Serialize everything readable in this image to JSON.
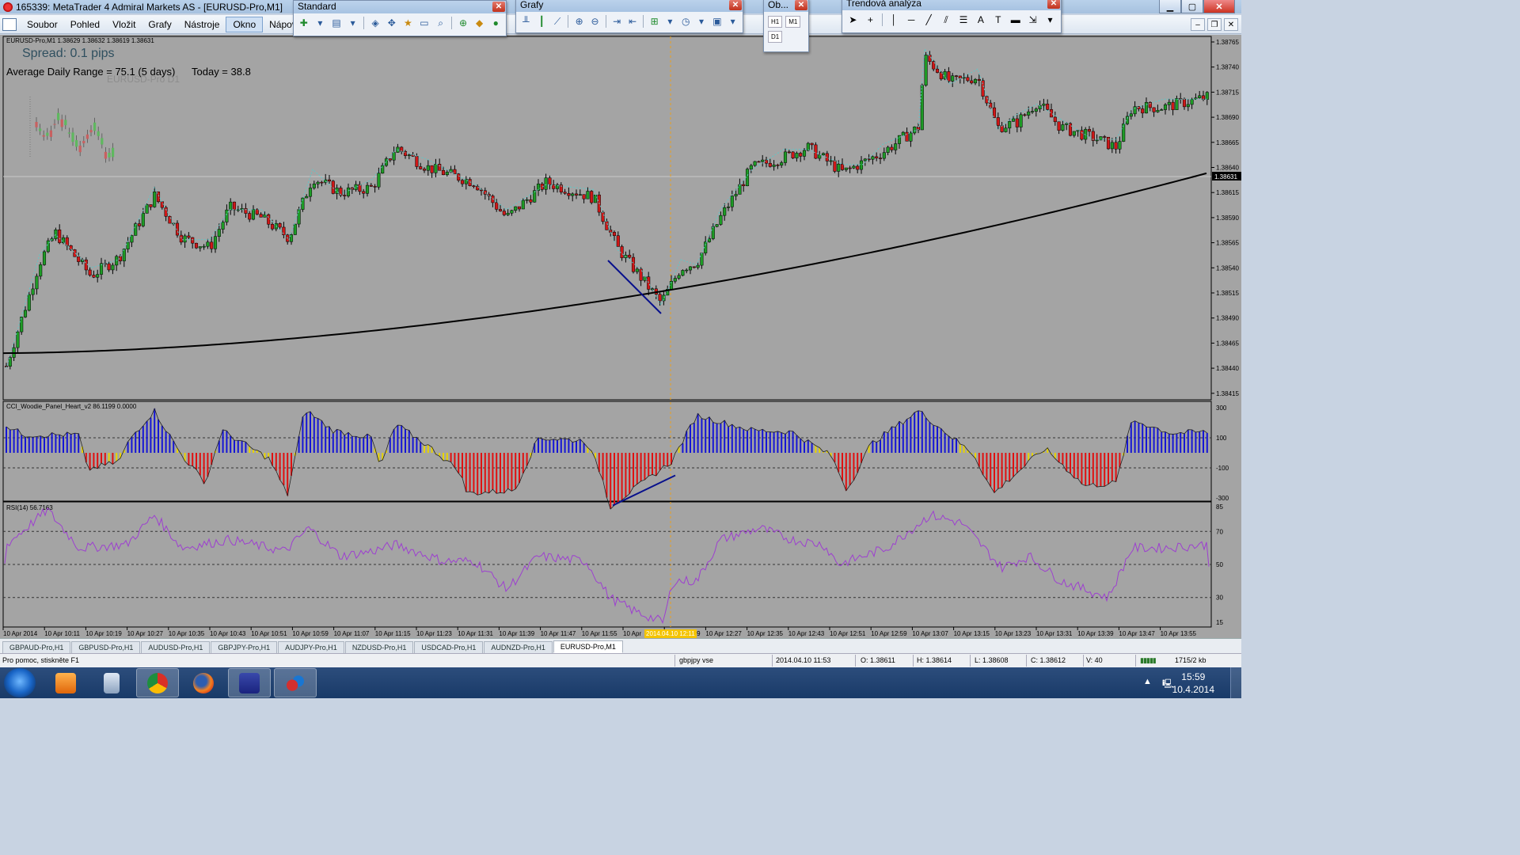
{
  "window": {
    "title": "165339: MetaTrader 4 Admiral Markets AS - [EURUSD-Pro,M1]"
  },
  "menu": [
    "Soubor",
    "Pohled",
    "Vložit",
    "Grafy",
    "Nástroje",
    "Okno",
    "Nápověda"
  ],
  "menu_active": "Okno",
  "toolbars": {
    "standard": {
      "title": "Standard"
    },
    "grafy": {
      "title": "Grafy"
    },
    "ob": {
      "title": "Ob...",
      "buttons": [
        "H1",
        "M1",
        "D1"
      ]
    },
    "trend": {
      "title": "Trendová analýza"
    }
  },
  "chart": {
    "header": "EURUSD-Pro,M1  1.38629 1.38632 1.38619 1.38631",
    "spread": "Spread: 0.1 pips",
    "adr": "Average Daily Range = 75.1 (5 days)",
    "today": "Today = 38.8",
    "mini_label": "EURUSD-Pro D1",
    "current_price": "1.38631",
    "price_axis": [
      "1.38765",
      "1.38740",
      "1.38715",
      "1.38690",
      "1.38665",
      "1.38640",
      "1.38615",
      "1.38590",
      "1.38565",
      "1.38540",
      "1.38515",
      "1.38490",
      "1.38465",
      "1.38440",
      "1.38415"
    ],
    "cci_label": "CCI_Woodie_Panel_Heart_v2 86.1199 0.0000",
    "cci_axis": [
      "300",
      "100",
      "-100",
      "-300"
    ],
    "rsi_label": "RSI(14) 56.7163",
    "rsi_axis": [
      "85",
      "70",
      "50",
      "30",
      "15"
    ],
    "time_axis": [
      "10 Apr 2014",
      "10 Apr 10:11",
      "10 Apr 10:19",
      "10 Apr 10:27",
      "10 Apr 10:35",
      "10 Apr 10:43",
      "10 Apr 10:51",
      "10 Apr 10:59",
      "10 Apr 11:07",
      "10 Apr 11:15",
      "10 Apr 11:23",
      "10 Apr 11:31",
      "10 Apr 11:39",
      "10 Apr 11:47",
      "10 Apr 11:55",
      "10 Apr",
      "10 Apr 12:19",
      "10 Apr 12:27",
      "10 Apr 12:35",
      "10 Apr 12:43",
      "10 Apr 12:51",
      "10 Apr 12:59",
      "10 Apr 13:07",
      "10 Apr 13:15",
      "10 Apr 13:23",
      "10 Apr 13:31",
      "10 Apr 13:39",
      "10 Apr 13:47",
      "10 Apr 13:55"
    ],
    "cursor_time": "2014.04.10 12:11",
    "colors": {
      "bull": "#1e9b26",
      "bear": "#d01818",
      "cci_pos": "#1515d6",
      "cci_neg": "#e01010",
      "cci_neutral": "#e8d400",
      "rsi": "#9d3fd0",
      "zigzag": "#5fc7c7",
      "ma": "#000000",
      "trendline": "#08108c",
      "background": "#a4a4a4"
    }
  },
  "tabs": [
    "GBPAUD-Pro,H1",
    "GBPUSD-Pro,H1",
    "AUDUSD-Pro,H1",
    "GBPJPY-Pro,H1",
    "AUDJPY-Pro,H1",
    "NZDUSD-Pro,H1",
    "USDCAD-Pro,H1",
    "AUDNZD-Pro,H1",
    "EURUSD-Pro,M1"
  ],
  "tab_active": "EURUSD-Pro,M1",
  "status": {
    "help": "Pro pomoc, stiskněte F1",
    "profile": "gbpjpy vse",
    "datetime": "2014.04.10 11:53",
    "open": "O: 1.38611",
    "high": "H: 1.38614",
    "low": "L: 1.38608",
    "close": "C: 1.38612",
    "volume": "V: 40",
    "traffic": "1715/2 kb"
  },
  "taskbar": {
    "time": "15:59",
    "date": "10.4.2014"
  }
}
